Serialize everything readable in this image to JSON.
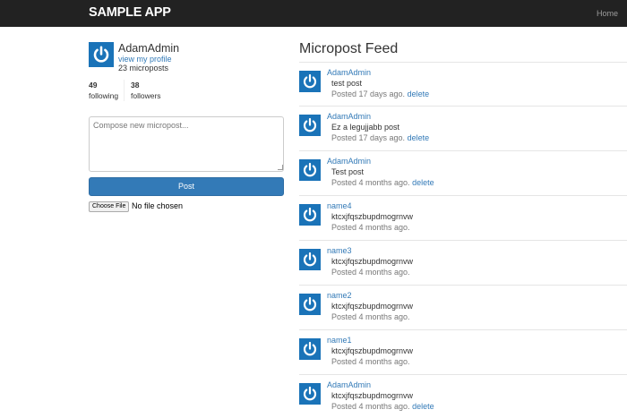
{
  "nav": {
    "logo": "SAMPLE APP",
    "home": "Home"
  },
  "profile": {
    "name": "AdamAdmin",
    "link": "view my profile",
    "count": "23 microposts",
    "following_count": "49",
    "following_label": "following",
    "followers_count": "38",
    "followers_label": "followers",
    "avatar_icon": "gravatar-power-icon"
  },
  "compose": {
    "placeholder": "Compose new micropost...",
    "post_label": "Post",
    "choose_file_label": "Choose File",
    "no_file_label": "No file chosen"
  },
  "feed": {
    "title": "Micropost Feed",
    "items": [
      {
        "user": "AdamAdmin",
        "content": "test post",
        "meta": "Posted 17 days ago.",
        "delete": "delete"
      },
      {
        "user": "AdamAdmin",
        "content": "Ez a legujjabb post",
        "meta": "Posted 17 days ago.",
        "delete": "delete"
      },
      {
        "user": "AdamAdmin",
        "content": "Test post",
        "meta": "Posted 4 months ago.",
        "delete": "delete"
      },
      {
        "user": "name4",
        "content": "ktcxjfqszbupdmogrnvw",
        "meta": "Posted 4 months ago.",
        "delete": ""
      },
      {
        "user": "name3",
        "content": "ktcxjfqszbupdmogrnvw",
        "meta": "Posted 4 months ago.",
        "delete": ""
      },
      {
        "user": "name2",
        "content": "ktcxjfqszbupdmogrnvw",
        "meta": "Posted 4 months ago.",
        "delete": ""
      },
      {
        "user": "name1",
        "content": "ktcxjfqszbupdmogrnvw",
        "meta": "Posted 4 months ago.",
        "delete": ""
      },
      {
        "user": "AdamAdmin",
        "content": "ktcxjfqszbupdmogrnvw",
        "meta": "Posted 4 months ago.",
        "delete": "delete"
      }
    ]
  },
  "colors": {
    "navbar": "#222222",
    "link": "#337ab7",
    "button": "#337ab7",
    "gravatar": "#1a73b8"
  }
}
